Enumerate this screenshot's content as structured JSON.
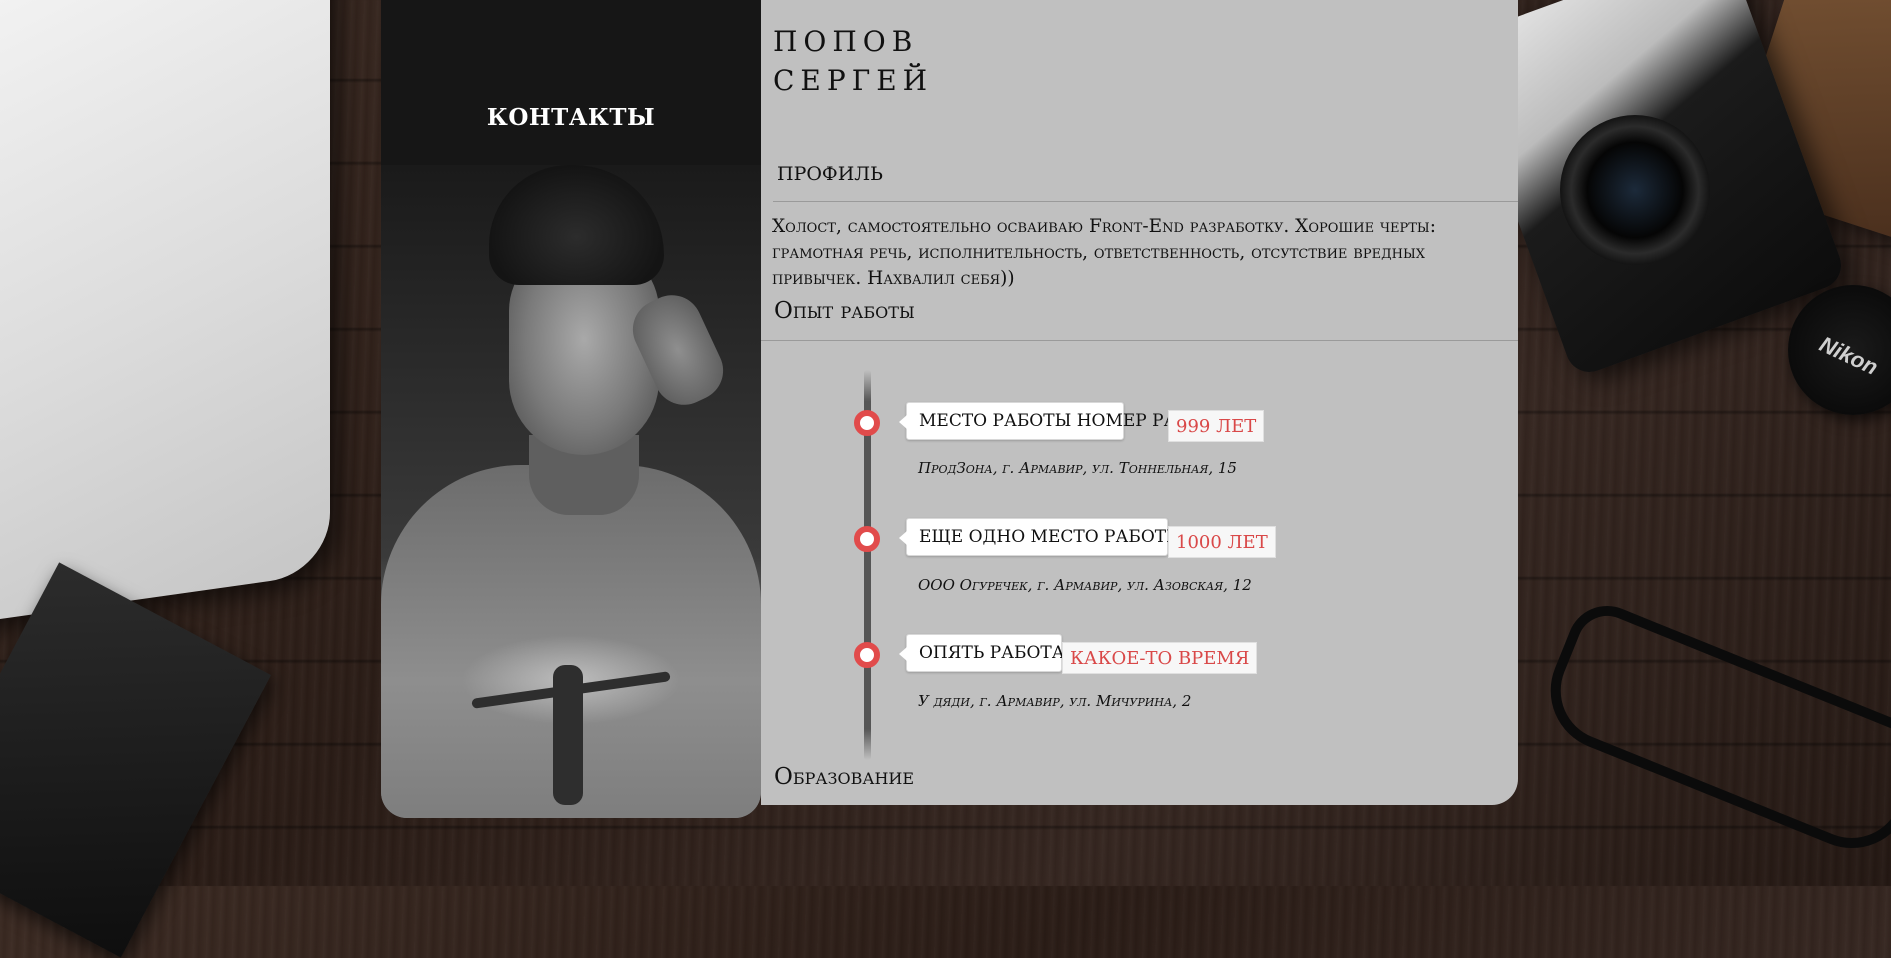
{
  "contacts": {
    "title": "КОНТАКТЫ"
  },
  "header": {
    "last_name": "ПОПОВ",
    "first_name": "СЕРГЕЙ"
  },
  "profile": {
    "title": "ПРОФИЛЬ",
    "text": "Холост, самостоятельно осваиваю Front-End разработку. Хорошие черты: грамотная речь, исполнительность, ответственность, отсутствие вредных привычек. Нахвалил себя))"
  },
  "experience": {
    "title": "Опыт работы",
    "items": [
      {
        "position": "МЕСТО РАБОТЫ НОМЕР РАЗ",
        "duration": "999 ЛЕТ",
        "place": "ПродЗона, г. Армавир, ул. Тоннельная, 15"
      },
      {
        "position": "ЕЩЕ ОДНО МЕСТО РАБОТЫ",
        "duration": "1000 ЛЕТ",
        "place": "ООО Огуречек, г. Армавир, ул. Азовская, 12"
      },
      {
        "position": "ОПЯТЬ РАБОТА",
        "duration": "КАКОЕ-ТО ВРЕМЯ",
        "place": "У дяди, г. Армавир, ул. Мичурина, 2"
      }
    ]
  },
  "education": {
    "title": "Образование"
  },
  "background": {
    "lenscap_brand": "Nikon"
  },
  "colors": {
    "accent": "#e14b4b",
    "card_bg": "#c0c0c0",
    "sidebar_bg": "#161616"
  }
}
